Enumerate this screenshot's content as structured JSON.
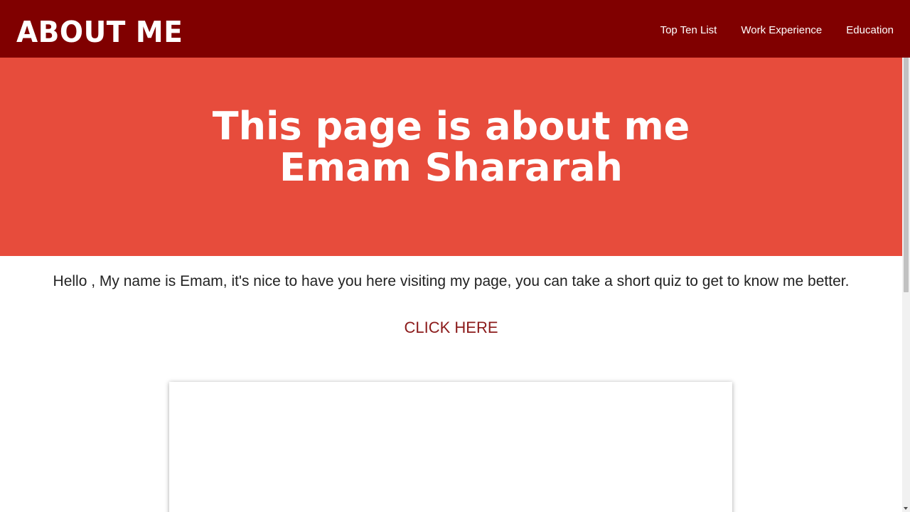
{
  "navbar": {
    "brand": "ABOUT ME",
    "links": [
      {
        "label": "Top Ten List"
      },
      {
        "label": "Work Experience"
      },
      {
        "label": "Education"
      }
    ]
  },
  "hero": {
    "title_line1": "This page is about me",
    "title_line2": "Emam Shararah"
  },
  "main": {
    "intro": "Hello , My name is Emam, it's nice to have you here visiting my page, you can take a short quiz to get to know me better.",
    "cta_label": "CLICK HERE"
  },
  "colors": {
    "navbar_bg": "#800000",
    "hero_bg": "#e74c3c",
    "cta_text": "#8b1a1a"
  }
}
